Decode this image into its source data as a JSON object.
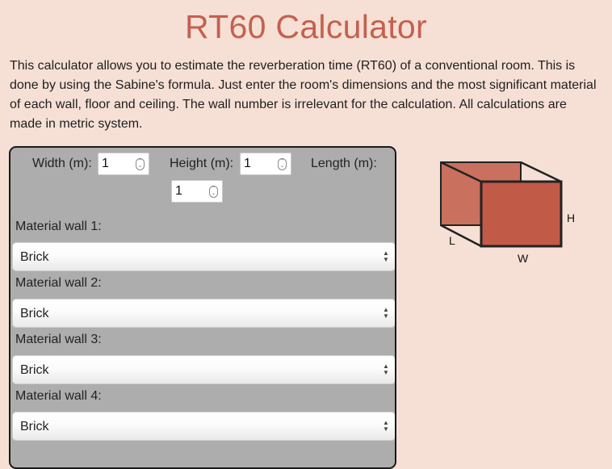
{
  "page": {
    "title": "RT60 Calculator",
    "intro": "This calculator allows you to estimate the reverberation time (RT60) of a conventional room. This is done by using the Sabine's formula. Just enter the room's dimensions and the most significant material of each wall, floor and ceiling. The wall number is irrelevant for the calculation. All calculations are made in metric system."
  },
  "dimensions": {
    "width_label": "Width (m):",
    "width_value": "1",
    "height_label": "Height (m):",
    "height_value": "1",
    "length_label": "Length (m):",
    "length_value": "1"
  },
  "materials": [
    {
      "label": "Material wall 1:",
      "value": "Brick"
    },
    {
      "label": "Material wall 2:",
      "value": "Brick"
    },
    {
      "label": "Material wall 3:",
      "value": "Brick"
    },
    {
      "label": "Material wall 4:",
      "value": "Brick"
    }
  ],
  "diagram": {
    "label_h": "H",
    "label_l": "L",
    "label_w": "W",
    "colors": {
      "front_face": "#c25a48",
      "back_face": "#c9705f",
      "edge": "#222222"
    }
  },
  "icons": {
    "spinner": "spinner-icon",
    "select_arrows": "select-arrows-icon"
  }
}
